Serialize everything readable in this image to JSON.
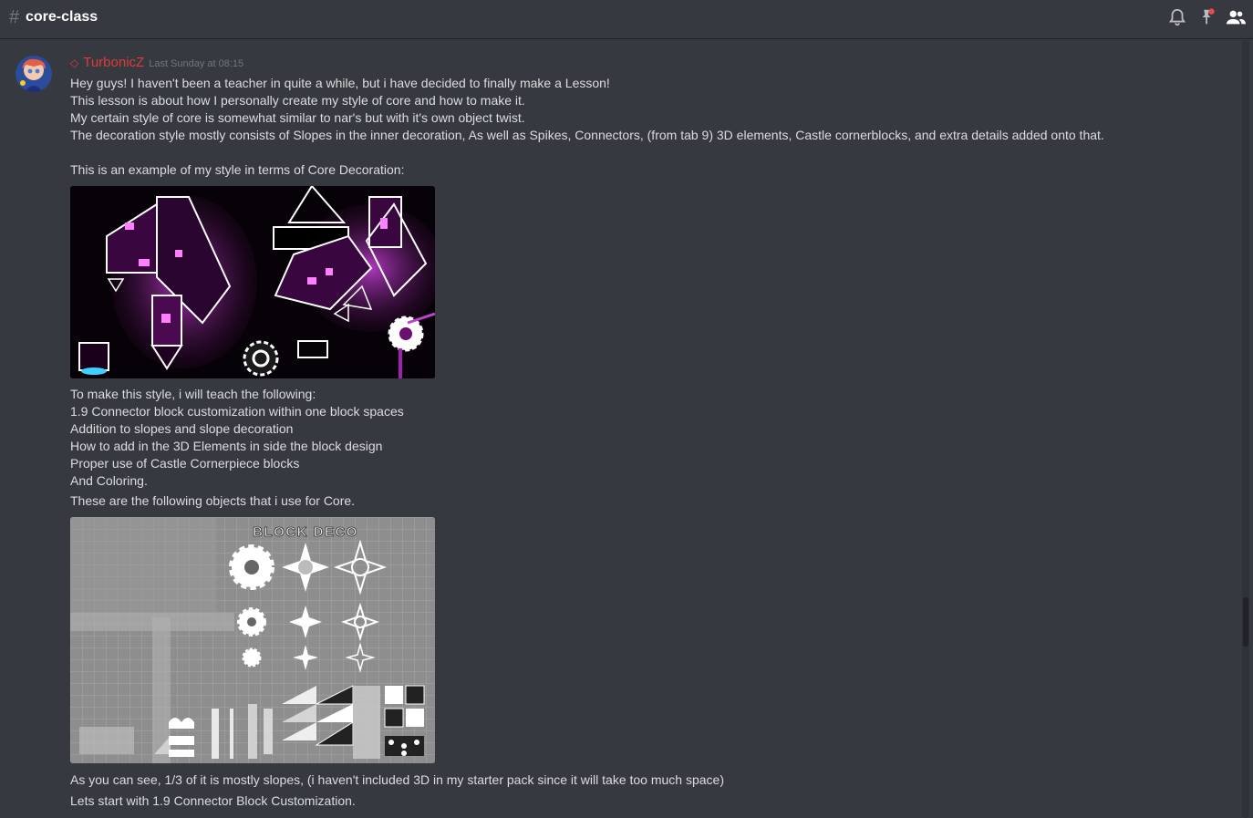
{
  "channel": {
    "name": "core-class"
  },
  "top_icons": [
    "bell-icon",
    "pin-icon",
    "members-icon"
  ],
  "message": {
    "author": "TurbonicZ",
    "role_icon": "◇",
    "timestamp": "Last Sunday at 08:15",
    "paragraph1": [
      "Hey guys! I haven't been a teacher in quite a while, but i have decided to finally make a Lesson!",
      "This lesson is about how I personally create my style of core and how to make it.",
      "My certain style of core is somewhat similar to nar's but with it's own object twist.",
      "The decoration style mostly consists of Slopes in the inner decoration, As well as Spikes, Connectors, (from tab 9) 3D elements, Castle cornerblocks, and extra details added onto that."
    ],
    "example_line": "This is an example of my style in terms of Core Decoration:",
    "paragraph2": [
      "To make this style, i will teach the following:",
      "1.9 Connector block customization within one block spaces",
      "Addition to slopes and slope decoration",
      "How to add in the 3D Elements in side the block design",
      "Proper use of Castle Cornerpiece blocks",
      "And Coloring."
    ],
    "objects_line": "These are the following objects that i use for Core.",
    "image2_label": "BLOCK DECO",
    "paragraph3": [
      "As you can see, 1/3 of it is mostly slopes, (i haven't included 3D in my starter pack since it will take too  much space)",
      "Lets start with 1.9 Connector Block Customization."
    ]
  },
  "colors": {
    "accent": "#e03a3a",
    "text": "#dcddde",
    "muted": "#72767d",
    "bg": "#36393f",
    "glow": "#e060ff"
  }
}
